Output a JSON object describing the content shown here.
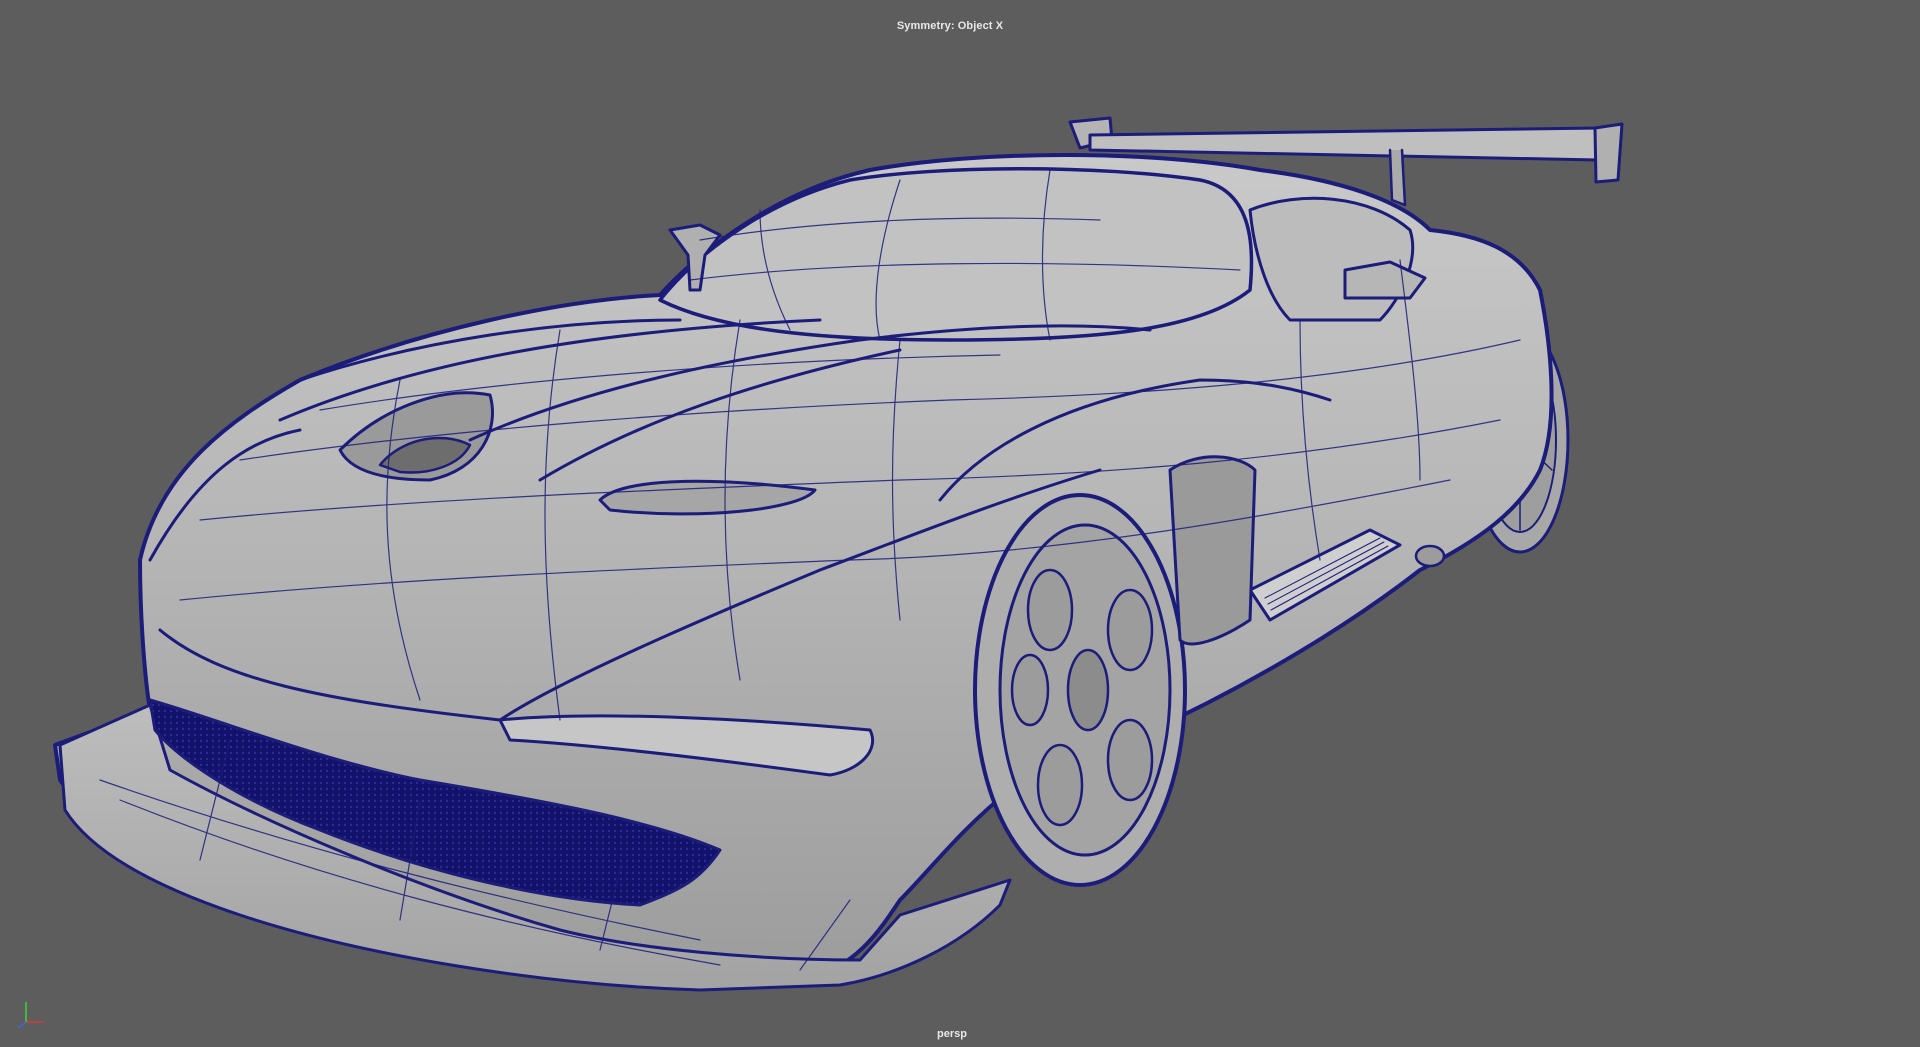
{
  "viewport": {
    "symmetry_label": "Symmetry: Object X",
    "camera_label": "persp",
    "model": "sports car wireframe-on-shaded",
    "colors": {
      "background": "#5d5d5d",
      "surface": "#b9b9b9",
      "wireframe": "#1c1c7a",
      "hud_text": "#e8e8e8"
    },
    "axis_gizmo": {
      "x_color": "#d63a3a",
      "y_color": "#3ad63a",
      "z_color": "#3a6ad6"
    }
  }
}
